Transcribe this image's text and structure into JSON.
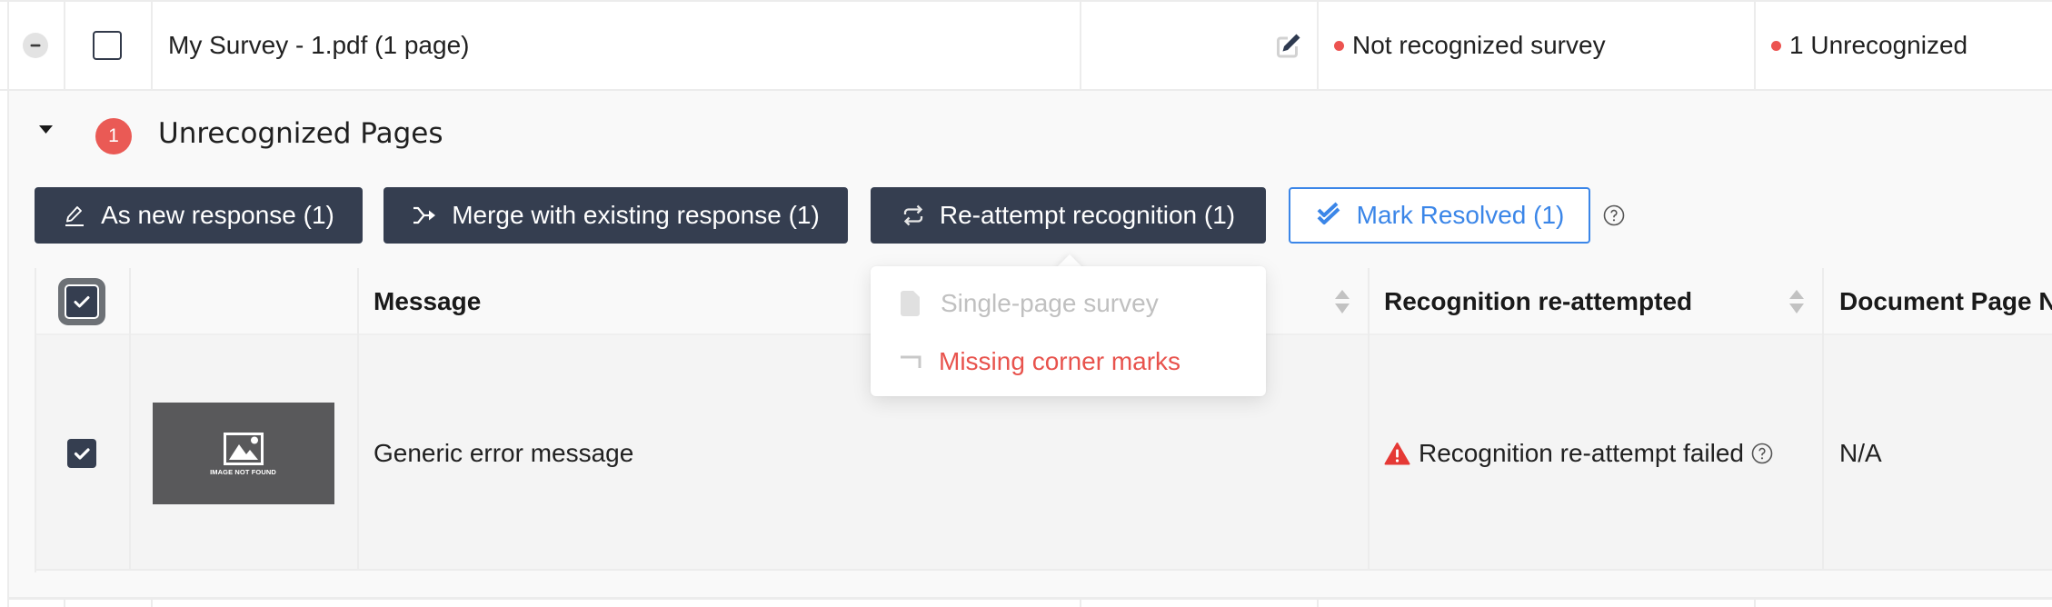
{
  "file_row": {
    "collapse_icon": "minus-circle-icon",
    "selected": false,
    "filename": "My Survey - 1.pdf (1 page)",
    "edit_icon": "edit-icon",
    "status": {
      "label": "Not recognized survey",
      "color": "#ec5350"
    },
    "summary": {
      "label": "1 Unrecognized",
      "color": "#ec5350"
    }
  },
  "section": {
    "expanded": true,
    "badge_count": "1",
    "badge_color": "#ea5a55",
    "title": "Unrecognized Pages",
    "actions": [
      {
        "label": "As new response (1)",
        "icon": "pencil-underline-icon",
        "style": "primary"
      },
      {
        "label": "Merge with existing response (1)",
        "icon": "merge-arrow-icon",
        "style": "primary"
      },
      {
        "label": "Re-attempt recognition (1)",
        "icon": "repeat-icon",
        "style": "primary"
      },
      {
        "label": "Mark Resolved (1)",
        "icon": "double-check-icon",
        "style": "outline"
      }
    ],
    "help_icon": "question-circle-icon"
  },
  "reattempt_dropdown": {
    "items": [
      {
        "label": "Single-page survey",
        "icon": "document-icon",
        "state": "disabled"
      },
      {
        "label": "Missing corner marks",
        "icon": "corner-mark-icon",
        "state": "error"
      }
    ]
  },
  "table": {
    "select_all_checked": true,
    "columns": [
      {
        "key": "select",
        "label": ""
      },
      {
        "key": "thumbnail",
        "label": ""
      },
      {
        "key": "message",
        "label": "Message",
        "sortable": true
      },
      {
        "key": "recognition",
        "label": "Recognition re-attempted",
        "sortable": true
      },
      {
        "key": "page",
        "label": "Document Page N"
      }
    ],
    "rows": [
      {
        "checked": true,
        "thumbnail_text": "IMAGE NOT FOUND",
        "message": "Generic error message",
        "recognition": "Recognition re-attempt failed",
        "recognition_icon": "warning-icon",
        "page": "N/A"
      }
    ]
  },
  "colors": {
    "primary": "#353e50",
    "accent": "#3b86e8",
    "danger": "#e53935",
    "error_text": "#e8534d",
    "disabled_text": "#c0c0c0"
  }
}
